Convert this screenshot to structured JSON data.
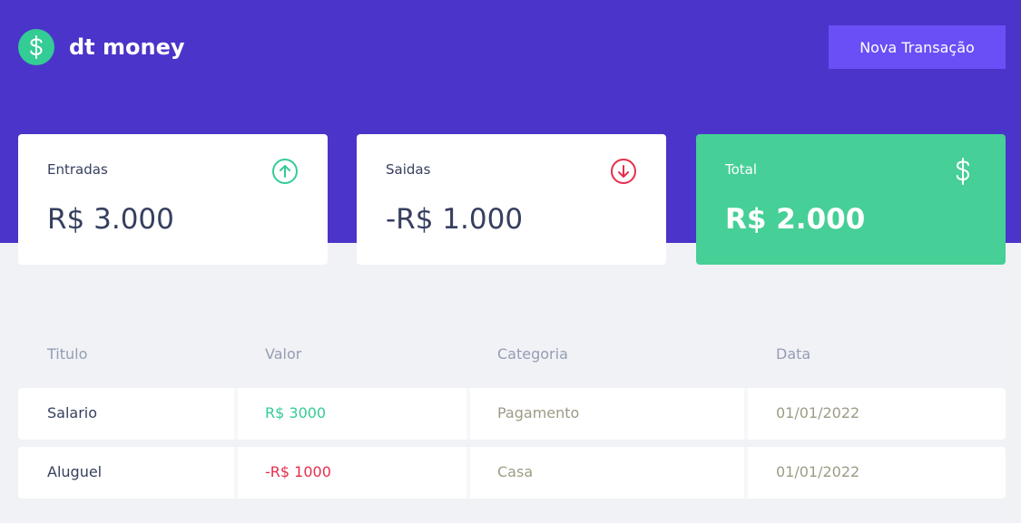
{
  "header": {
    "brand": "dt money",
    "new_transaction_label": "Nova Transação"
  },
  "summary": {
    "cards": [
      {
        "label": "Entradas",
        "value": "R$ 3.000",
        "icon": "arrow-up-circle-icon",
        "icon_color": "#33cc95"
      },
      {
        "label": "Saidas",
        "value": "-R$ 1.000",
        "icon": "arrow-down-circle-icon",
        "icon_color": "#e52e4d"
      },
      {
        "label": "Total",
        "value": "R$ 2.000",
        "icon": "dollar-icon",
        "icon_color": "#ffffff",
        "background": "#46cf96"
      }
    ]
  },
  "table": {
    "columns": [
      "Titulo",
      "Valor",
      "Categoria",
      "Data"
    ],
    "rows": [
      {
        "title": "Salario",
        "amount": "R$ 3000",
        "type": "deposit",
        "category": "Pagamento",
        "date": "01/01/2022"
      },
      {
        "title": "Aluguel",
        "amount": "-R$ 1000",
        "type": "withdraw",
        "category": "Casa",
        "date": "01/01/2022"
      }
    ]
  },
  "colors": {
    "header_bg": "#4b34c9",
    "button_bg": "#6a4ff6",
    "green": "#33cc95",
    "red": "#e52e4d",
    "page_bg": "#f0f2f5"
  }
}
